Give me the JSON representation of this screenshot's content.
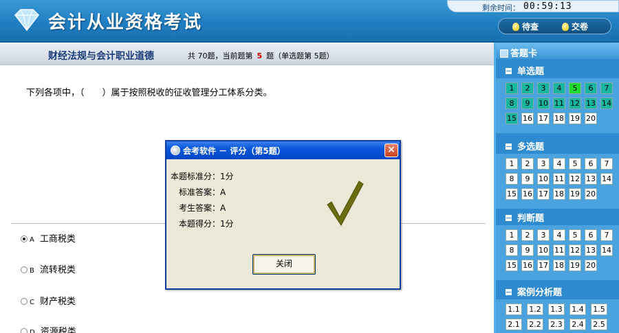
{
  "header": {
    "title": "会计从业资格考试",
    "logo_icon": "diamond-icon",
    "timer_label": "剩余时间：",
    "timer_value": "00:59:13",
    "review_label": "待查",
    "submit_label": "交卷"
  },
  "subheader": {
    "subject": "财经法规与会计职业道德",
    "info_prefix": "共 70题，当前题第",
    "current_no": "5",
    "info_suffix": "题（单选题第 5题）"
  },
  "question": {
    "text": "下列各项中，（　　）属于按照税收的征收管理分工体系分类。",
    "options": [
      {
        "letter": "A",
        "text": "工商税类",
        "selected": true
      },
      {
        "letter": "B",
        "text": "流转税类",
        "selected": false
      },
      {
        "letter": "C",
        "text": "财产税类",
        "selected": false
      },
      {
        "letter": "D",
        "text": "资源税类",
        "selected": false
      }
    ]
  },
  "answer_card": {
    "title": "答题卡",
    "sections": [
      {
        "name": "单选题",
        "items": [
          "1",
          "2",
          "3",
          "4",
          "5",
          "6",
          "7",
          "8",
          "9",
          "10",
          "11",
          "12",
          "13",
          "14",
          "15",
          "16",
          "17",
          "18",
          "19",
          "20"
        ]
      },
      {
        "name": "多选题",
        "items": [
          "1",
          "2",
          "3",
          "4",
          "5",
          "6",
          "7",
          "8",
          "9",
          "10",
          "11",
          "12",
          "13",
          "14",
          "15",
          "16",
          "17",
          "18",
          "19",
          "20"
        ]
      },
      {
        "name": "判断题",
        "items": [
          "1",
          "2",
          "3",
          "4",
          "5",
          "6",
          "7",
          "8",
          "9",
          "10",
          "11",
          "12",
          "13",
          "14",
          "15",
          "16",
          "17",
          "18",
          "19",
          "20"
        ]
      },
      {
        "name": "案例分析题",
        "items": [
          "1.1",
          "1.2",
          "1.3",
          "1.4",
          "1.5",
          "2.1",
          "2.2",
          "2.3",
          "2.4",
          "2.5"
        ]
      }
    ],
    "answered_single": [
      "1",
      "2",
      "3",
      "4",
      "6",
      "7",
      "8",
      "9",
      "10",
      "11",
      "12",
      "13",
      "14",
      "15"
    ],
    "current_single": "5",
    "colors": {
      "answered": "#17b6a0",
      "current": "#1fdc30",
      "panel": "#2f8bcf"
    }
  },
  "dialog": {
    "title": "会考软件 － 评分（第5题）",
    "rows": [
      {
        "label": "本题标准分：",
        "value": "1分"
      },
      {
        "label": "标准答案：",
        "value": "A"
      },
      {
        "label": "考生答案：",
        "value": "A"
      },
      {
        "label": "本题得分：",
        "value": "1分"
      }
    ],
    "close_label": "关闭",
    "result_icon": "checkmark-icon",
    "close_icon": "close-icon"
  }
}
